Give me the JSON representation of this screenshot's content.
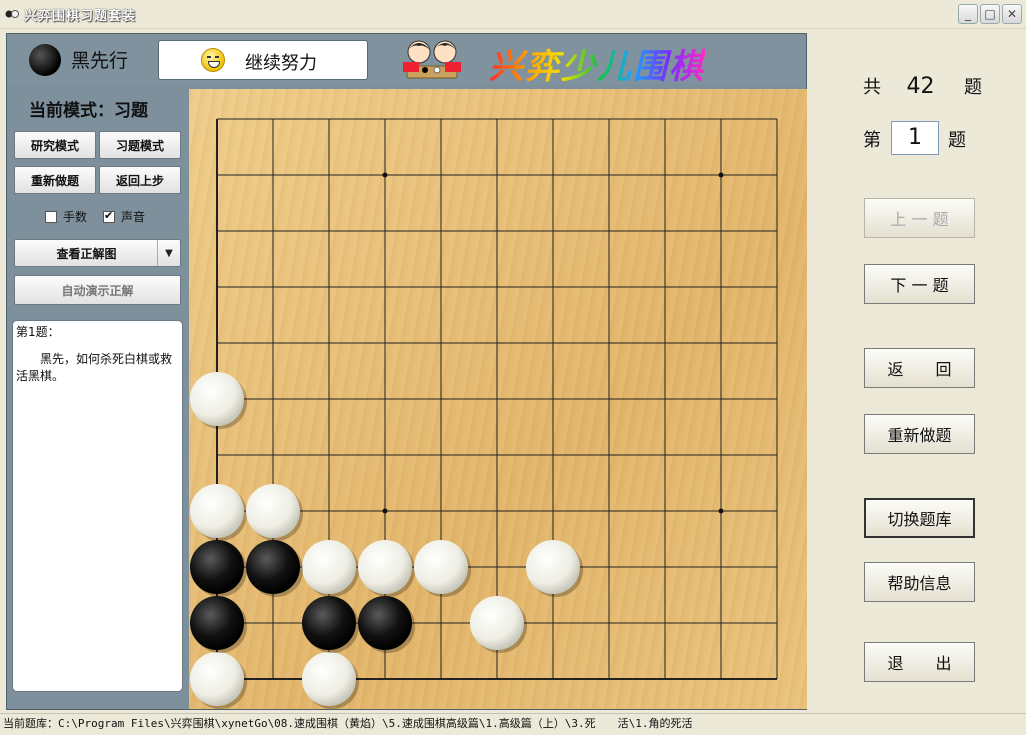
{
  "window": {
    "title": "兴弈围棋习题套装",
    "min_symbol": "_",
    "max_symbol": "□",
    "close_symbol": "✕"
  },
  "topbar": {
    "turn_label": "黑先行",
    "status_text": "继续努力",
    "brand_text": "兴弈少儿围棋"
  },
  "left_panel": {
    "mode_label": "当前模式：习题",
    "research_mode": "研究模式",
    "exercise_mode": "习题模式",
    "redo": "重新做题",
    "undo": "返回上步",
    "move_numbers": "手数",
    "sound": "声音",
    "sound_checked": true,
    "move_numbers_checked": false,
    "view_solution": "查看正解图",
    "auto_demo": "自动演示正解",
    "problem_number": "第1题：",
    "problem_text": "黑先，如何杀死白棋或救活黑棋。"
  },
  "board": {
    "grid_lines": 11,
    "hoshi": [
      [
        3,
        1
      ],
      [
        9,
        1
      ],
      [
        3,
        7
      ],
      [
        9,
        7
      ]
    ],
    "white_stones": [
      [
        0,
        5
      ],
      [
        0,
        7
      ],
      [
        1,
        7
      ],
      [
        2,
        8
      ],
      [
        3,
        8
      ],
      [
        4,
        8
      ],
      [
        6,
        8
      ],
      [
        5,
        9
      ],
      [
        0,
        10
      ],
      [
        2,
        10
      ]
    ],
    "black_stones": [
      [
        0,
        8
      ],
      [
        1,
        8
      ],
      [
        0,
        9
      ],
      [
        2,
        9
      ],
      [
        3,
        9
      ]
    ]
  },
  "right_panel": {
    "total_prefix": "共",
    "total_count": "42",
    "total_suffix": "题",
    "current_prefix": "第",
    "current_value": "1",
    "current_suffix": "题",
    "prev": "上 一 题",
    "next": "下 一 题",
    "back": "返　　回",
    "redo": "重新做题",
    "switch_bank": "切换题库",
    "help": "帮助信息",
    "exit": "退　　出"
  },
  "statusbar": {
    "text": "当前题库：C:\\Program Files\\兴弈围棋\\xynetGo\\08.速成围棋（黄焰）\\5.速成围棋高级篇\\1.高级篇（上）\\3.死　　活\\1.角的死活"
  }
}
